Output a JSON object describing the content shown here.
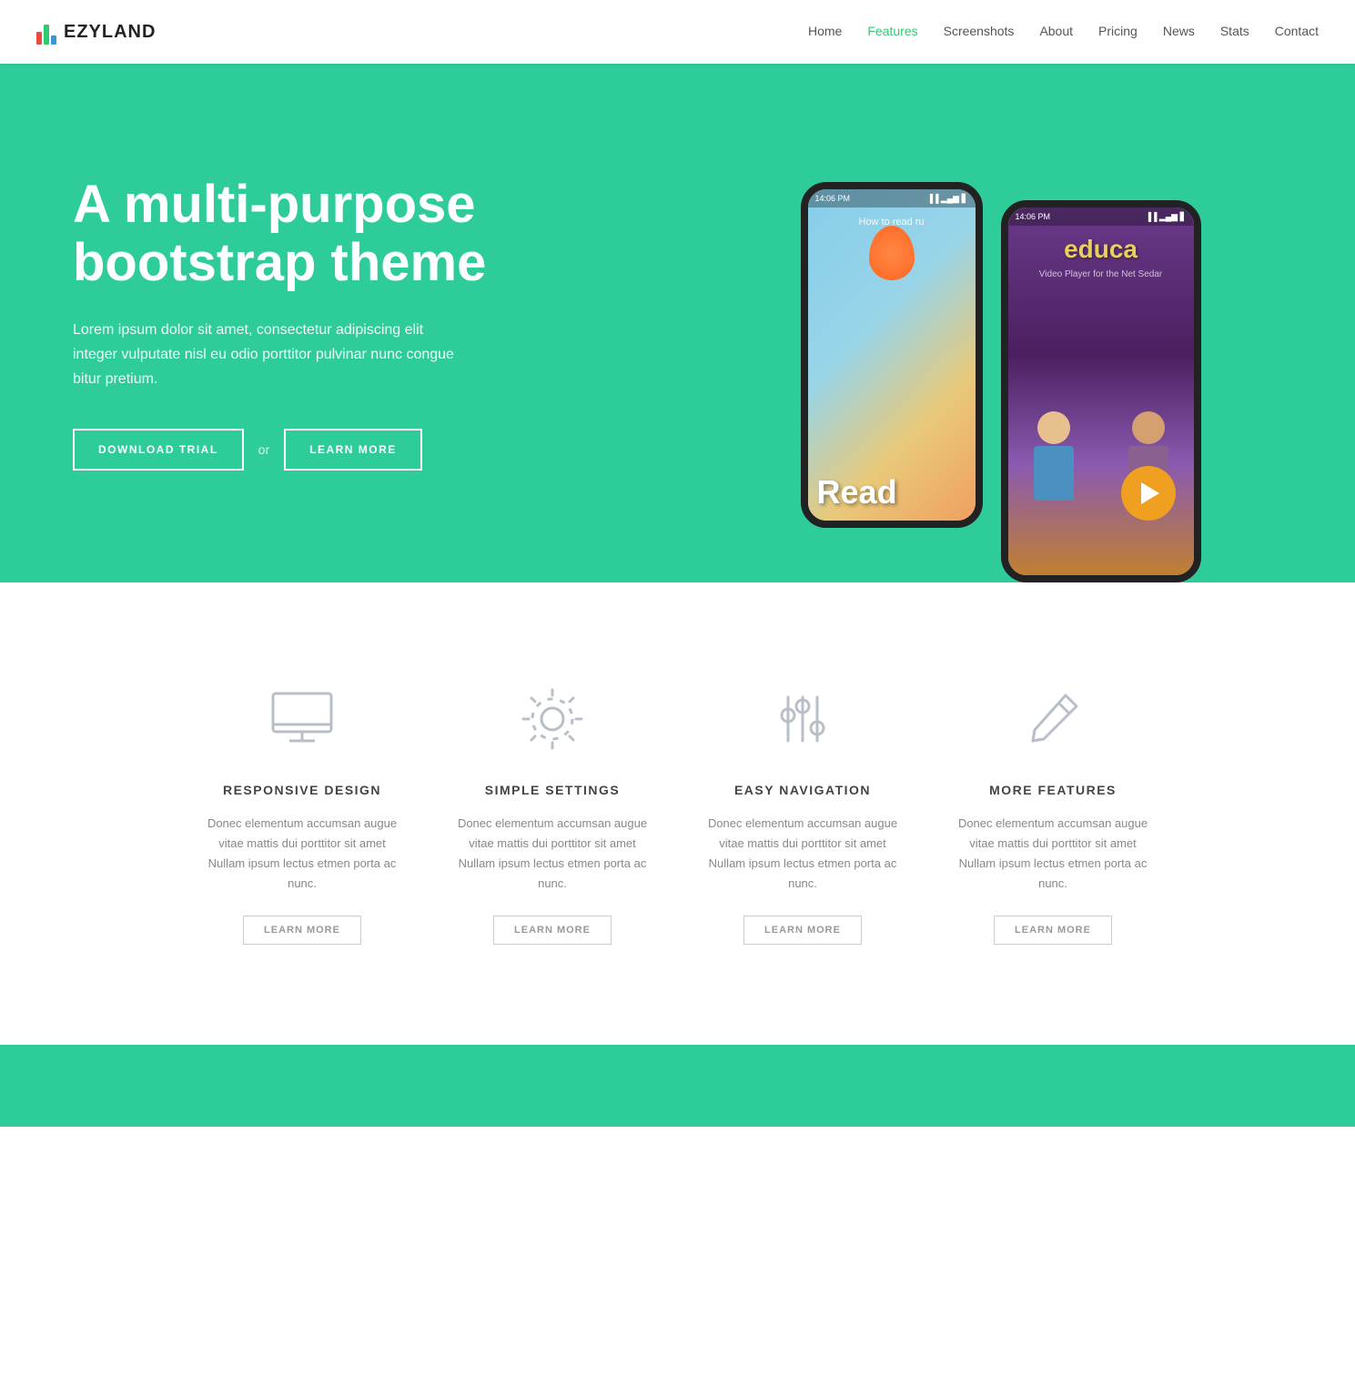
{
  "navbar": {
    "logo_text": "EZYLAND",
    "links": [
      {
        "label": "Home",
        "active": false
      },
      {
        "label": "Features",
        "active": true
      },
      {
        "label": "Screenshots",
        "active": false
      },
      {
        "label": "About",
        "active": false
      },
      {
        "label": "Pricing",
        "active": false
      },
      {
        "label": "News",
        "active": false
      },
      {
        "label": "Stats",
        "active": false
      },
      {
        "label": "Contact",
        "active": false
      }
    ]
  },
  "hero": {
    "title": "A multi-purpose bootstrap theme",
    "description": "Lorem ipsum dolor sit amet, consectetur adipiscing elit integer vulputate nisl eu odio porttitor pulvinar nunc congue bitur pretium.",
    "btn_download": "DOWNLOAD TRIAL",
    "btn_or": "or",
    "btn_learn": "LEARN MORE",
    "phone_left_status": "14:06 PM",
    "phone_right_status": "14:06 PM",
    "phone_left_text": "Read",
    "phone_left_subtext": "How to read ru",
    "phone_right_text": "educa",
    "phone_right_subtext": "Video Player for the Net Sedar"
  },
  "features": {
    "items": [
      {
        "icon": "monitor",
        "title": "RESPONSIVE DESIGN",
        "description": "Donec elementum accumsan augue vitae mattis dui porttitor sit amet Nullam ipsum lectus etmen porta ac nunc.",
        "button": "LEARN MORE"
      },
      {
        "icon": "settings",
        "title": "SIMPLE SETTINGS",
        "description": "Donec elementum accumsan augue vitae mattis dui porttitor sit amet Nullam ipsum lectus etmen porta ac nunc.",
        "button": "LEARN MORE"
      },
      {
        "icon": "sliders",
        "title": "EASY NAVIGATION",
        "description": "Donec elementum accumsan augue vitae mattis dui porttitor sit amet Nullam ipsum lectus etmen porta ac nunc.",
        "button": "LEARN MORE"
      },
      {
        "icon": "pencil",
        "title": "MORE FEATURES",
        "description": "Donec elementum accumsan augue vitae mattis dui porttitor sit amet Nullam ipsum lectus etmen porta ac nunc.",
        "button": "LEARN MORE"
      }
    ]
  }
}
